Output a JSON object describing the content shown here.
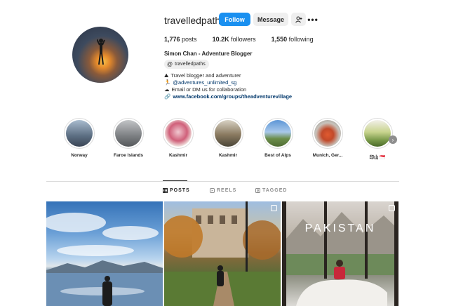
{
  "profile": {
    "username": "travelledpaths",
    "follow_label": "Follow",
    "message_label": "Message",
    "more_label": "•••",
    "posts_count": "1,776",
    "posts_label": "posts",
    "followers_count": "10.2K",
    "followers_label": "followers",
    "following_count": "1,550",
    "following_label": "following",
    "full_name": "Simon Chan - Adventure Blogger",
    "threads_handle": "travelledpaths",
    "bio": [
      {
        "emoji": "⛰",
        "text": "Travel blogger and adventurer"
      },
      {
        "emoji": "🏃",
        "text": "@adventures_unlimited_sg"
      },
      {
        "emoji": "☁",
        "text": "Email or DM us for collaboration"
      },
      {
        "emoji": "🔗",
        "text": "www.facebook.com/groups/theadventurevillage"
      }
    ]
  },
  "highlights": [
    {
      "label": "Norway",
      "color": "#7a8fa8"
    },
    {
      "label": "Faroe Islands",
      "color": "#8a8c8f"
    },
    {
      "label": "Kashmir",
      "color": "#d47a8a"
    },
    {
      "label": "Kashmir",
      "color": "#8a7a60"
    },
    {
      "label": "Best of Alps",
      "color": "#6e9dd0"
    },
    {
      "label": "Munich, Ger...",
      "color": "#c85a3a"
    },
    {
      "label": "印山 🇸🇬",
      "color": "#b8c888"
    }
  ],
  "tabs": {
    "posts": "POSTS",
    "reels": "REELS",
    "tagged": "TAGGED"
  },
  "posts": [
    {
      "overlay_text": ""
    },
    {
      "overlay_text": ""
    },
    {
      "overlay_text": "PAKISTAN"
    }
  ],
  "colors": {
    "accent": "#1a90f0",
    "link": "#00376b"
  }
}
